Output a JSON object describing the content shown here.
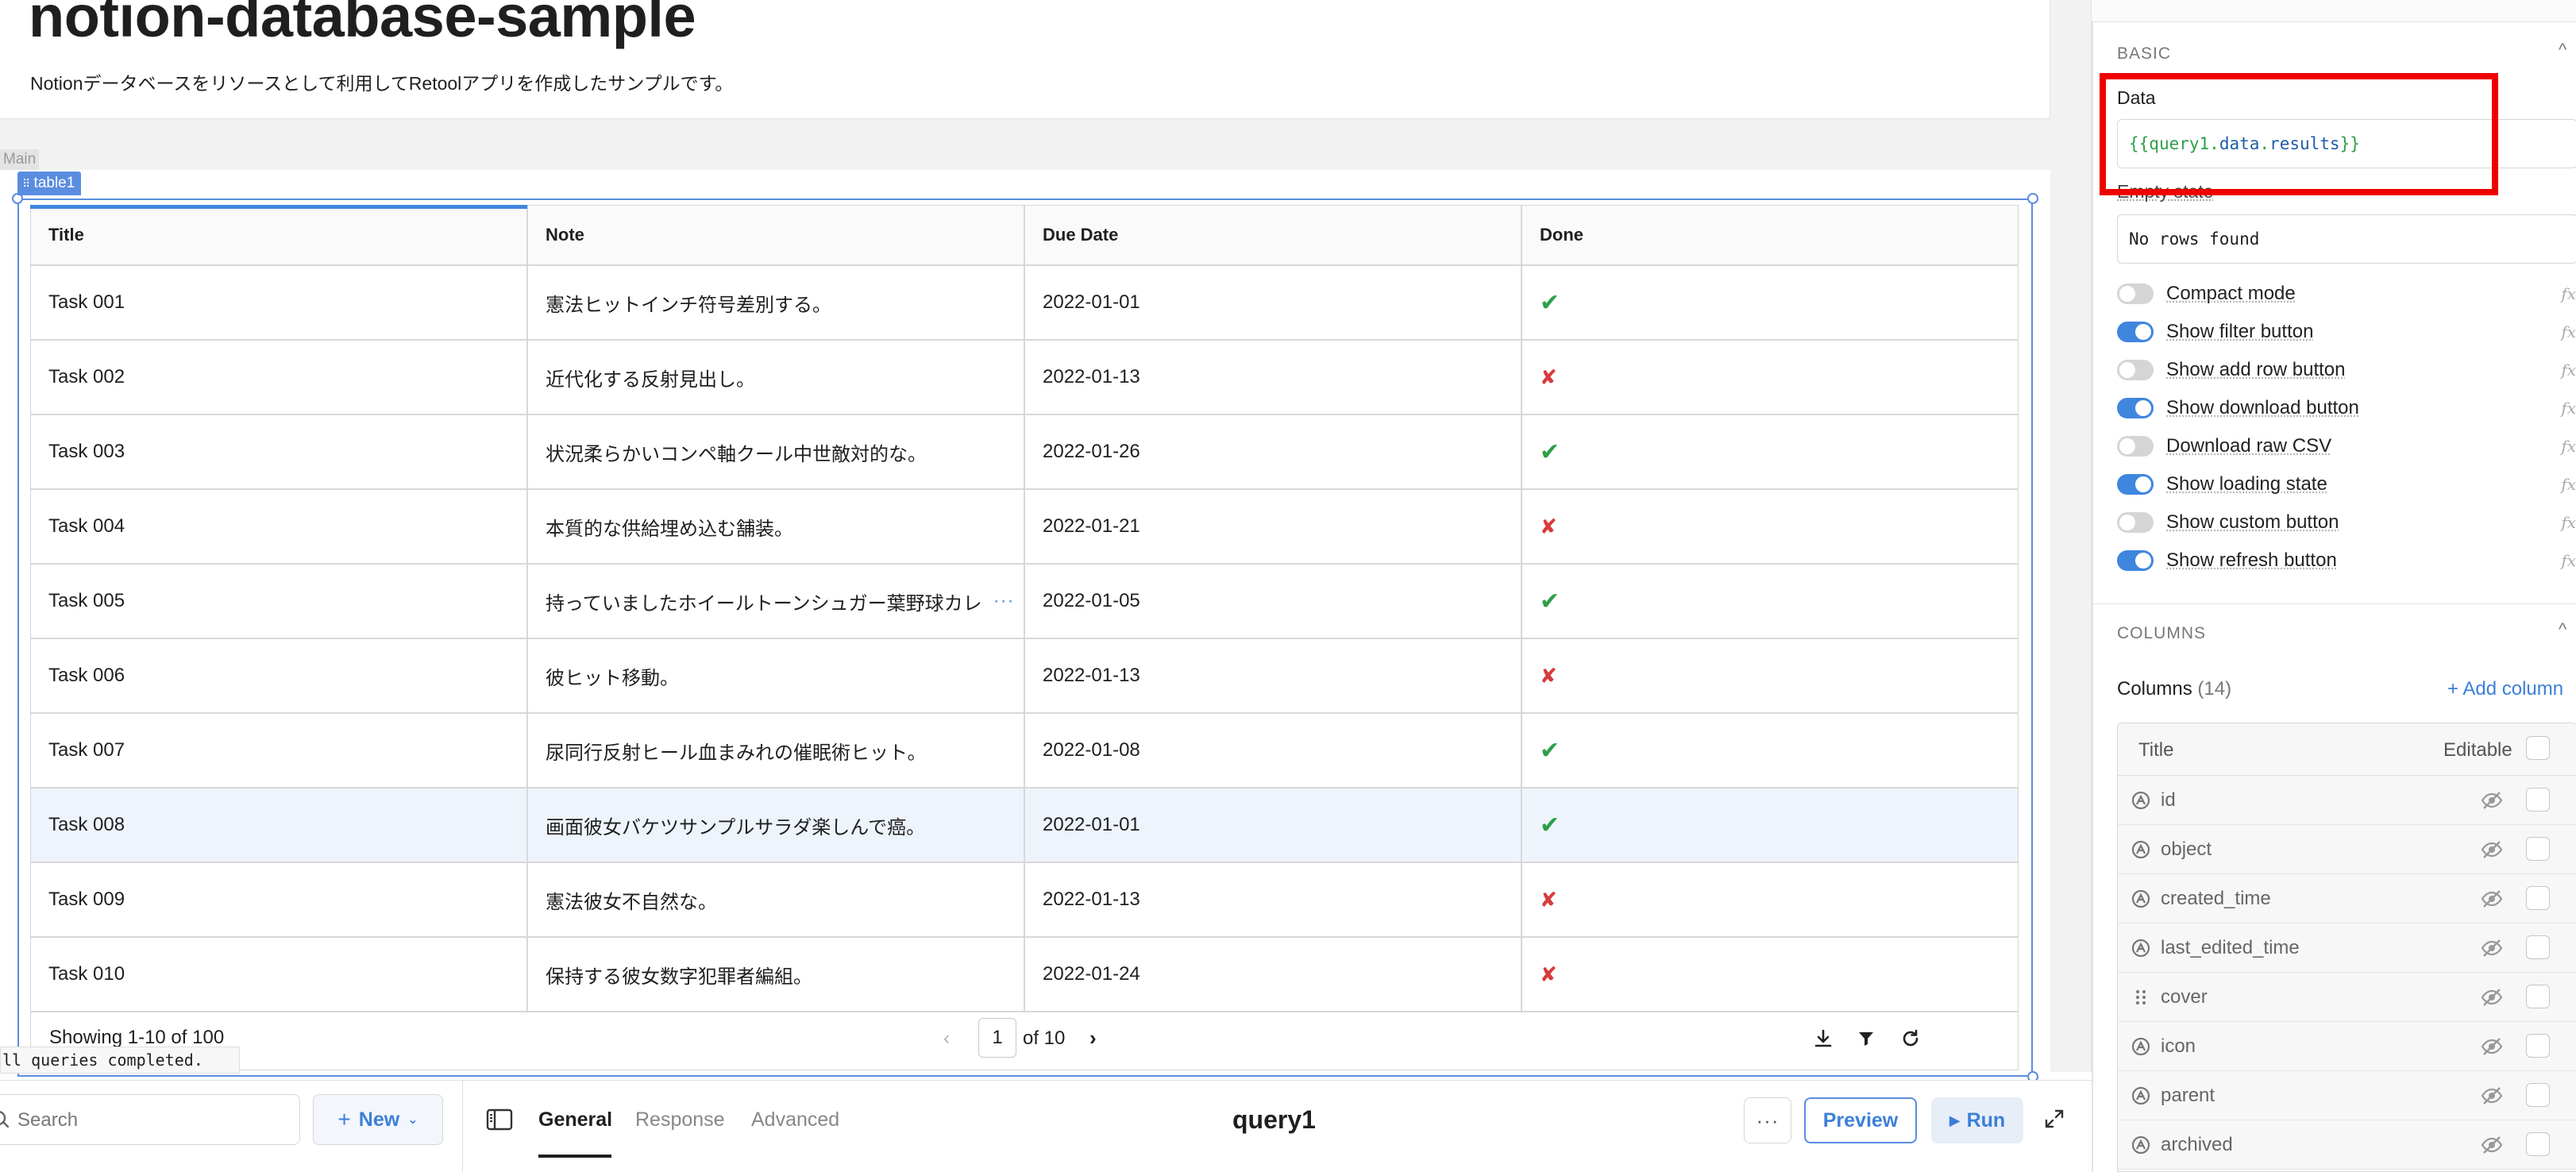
{
  "app": {
    "title": "notion-database-sample",
    "subtitle": "Notionデータベースをリソースとして利用してRetoolアプリを作成したサンプルです。",
    "main_tag": "Main",
    "table_tag": "table1",
    "toast": "ll queries completed."
  },
  "table": {
    "headers": [
      "Title",
      "Note",
      "Due Date",
      "Done"
    ],
    "rows": [
      {
        "title": "Task 001",
        "note": "憲法ヒットインチ符号差別する。",
        "due": "2022-01-01",
        "done": "✔",
        "done_value": true
      },
      {
        "title": "Task 002",
        "note": "近代化する反射見出し。",
        "due": "2022-01-13",
        "done": "✘",
        "done_value": false
      },
      {
        "title": "Task 003",
        "note": "状況柔らかいコンペ軸クール中世敵対的な。",
        "due": "2022-01-26",
        "done": "✔",
        "done_value": true
      },
      {
        "title": "Task 004",
        "note": "本質的な供給埋め込む舗装。",
        "due": "2022-01-21",
        "done": "✘",
        "done_value": false
      },
      {
        "title": "Task 005",
        "note": "持っていましたホイールトーンシュガー葉野球カレ",
        "due": "2022-01-05",
        "done": "✔",
        "done_value": true
      },
      {
        "title": "Task 006",
        "note": "彼ヒット移動。",
        "due": "2022-01-13",
        "done": "✘",
        "done_value": false
      },
      {
        "title": "Task 007",
        "note": "尿同行反射ヒール血まみれの催眠術ヒット。",
        "due": "2022-01-08",
        "done": "✔",
        "done_value": true
      },
      {
        "title": "Task 008",
        "note": "画面彼女バケツサンプルサラダ楽しんで癌。",
        "due": "2022-01-01",
        "done": "✔",
        "done_value": true
      },
      {
        "title": "Task 009",
        "note": "憲法彼女不自然な。",
        "due": "2022-01-13",
        "done": "✘",
        "done_value": false
      },
      {
        "title": "Task 010",
        "note": "保持する彼女数字犯罪者編組。",
        "due": "2022-01-24",
        "done": "✘",
        "done_value": false
      }
    ],
    "truncated_more": "···",
    "footer": {
      "showing": "Showing 1-10 of 100",
      "page": "1",
      "of_pages": "of 10",
      "prev": "‹",
      "next": "›"
    }
  },
  "bottom_panel": {
    "search_placeholder": "Search",
    "new_label": "New",
    "tabs": [
      "General",
      "Response",
      "Advanced"
    ],
    "query_name": "query1",
    "more": "···",
    "preview_label": "Preview",
    "run_label": "Run"
  },
  "inspector": {
    "basic_title": "BASIC",
    "data_label": "Data",
    "data_value": {
      "open": "{{",
      "part1": "query1",
      "dot1": ".",
      "part2": "data",
      "dot2": ".",
      "part3": "results",
      "close": "}}"
    },
    "empty_state_label": "Empty state",
    "empty_state_value": "No rows found",
    "fx": "fx",
    "toggles": [
      {
        "label": "Compact mode",
        "on": false
      },
      {
        "label": "Show filter button",
        "on": true
      },
      {
        "label": "Show add row button",
        "on": false
      },
      {
        "label": "Show download button",
        "on": true
      },
      {
        "label": "Download raw CSV",
        "on": false
      },
      {
        "label": "Show loading state",
        "on": true
      },
      {
        "label": "Show custom button",
        "on": false
      },
      {
        "label": "Show refresh button",
        "on": true
      }
    ],
    "columns_title": "COLUMNS",
    "columns_label": "Columns",
    "columns_count": "(14)",
    "add_column": "+ Add column",
    "col_header_title": "Title",
    "col_header_editable": "Editable",
    "columns": [
      "id",
      "object",
      "created_time",
      "last_edited_time",
      "cover",
      "icon",
      "parent",
      "archived"
    ]
  },
  "colors": {
    "accent": "#3f86df",
    "check": "#2d9f48",
    "cross": "#d83b3b",
    "highlight": "#ef0000"
  }
}
